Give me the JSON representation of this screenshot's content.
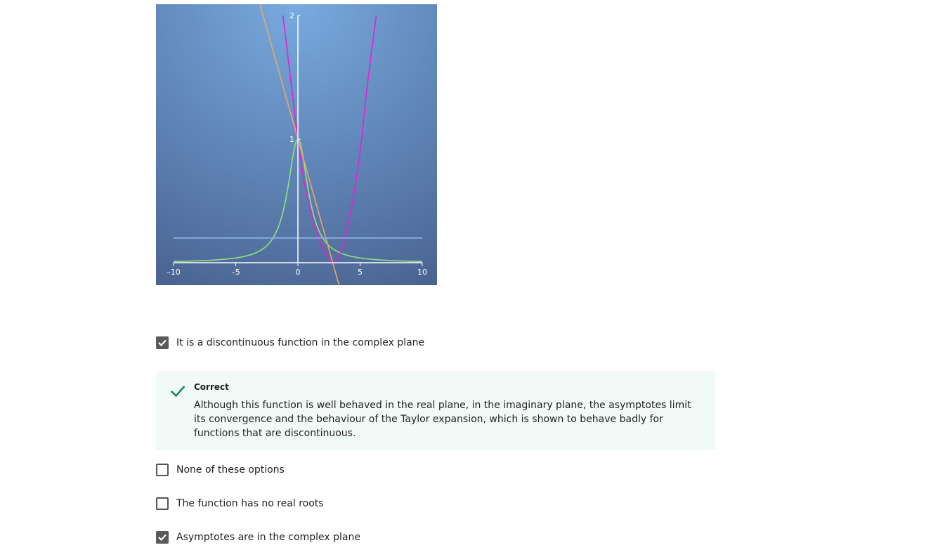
{
  "chart_data": {
    "type": "line",
    "x_ticks": [
      "–10",
      "–5",
      "0",
      "5",
      "10"
    ],
    "y_ticks": [
      "1",
      "2"
    ],
    "xlim": [
      -10,
      10
    ],
    "ylim": [
      -0.07,
      2.0
    ],
    "series": [
      {
        "function": "1/(1+x^2)",
        "color": "#8ee37e"
      },
      {
        "function": "1 - x/2.8",
        "color": "#e8a865"
      },
      {
        "function": "Taylor polynomial",
        "color": "#e71fd6",
        "points": [
          [
            -1.2,
            2.0
          ],
          [
            -0.6,
            1.5
          ],
          [
            0,
            1.0
          ],
          [
            0.6,
            0.6
          ],
          [
            1.2,
            0.35
          ],
          [
            1.8,
            0.16
          ],
          [
            2.4,
            0.05
          ],
          [
            2.85,
            0.0
          ],
          [
            3.3,
            0.05
          ],
          [
            3.9,
            0.25
          ],
          [
            4.5,
            0.55
          ],
          [
            5.1,
            0.98
          ],
          [
            5.6,
            1.45
          ],
          [
            6.3,
            2.0
          ]
        ]
      },
      {
        "function": "y = 0.2",
        "color": "#8fb5ec"
      }
    ],
    "background": {
      "top": "#78aae0",
      "bottom": "#4a6492"
    },
    "grid": false
  },
  "options": [
    {
      "label": "It is a discontinuous function in the complex plane",
      "checked": true
    },
    {
      "label": "None of these options",
      "checked": false
    },
    {
      "label": "The function has no real roots",
      "checked": false
    },
    {
      "label": "Asymptotes are in the complex plane",
      "checked": true
    }
  ],
  "feedback": {
    "status": "Correct",
    "text": "Although this function is well behaved in the real plane, in the imaginary plane, the asymptotes limit its convergence and the behaviour of the Taylor expansion, which is shown to behave badly for functions that are discontinuous.",
    "icon": "checkmark-icon",
    "color": "#127a52"
  },
  "colors": {
    "checkbox_checked": "#5a5a5a",
    "feedback_bg": "#f2faf7"
  }
}
